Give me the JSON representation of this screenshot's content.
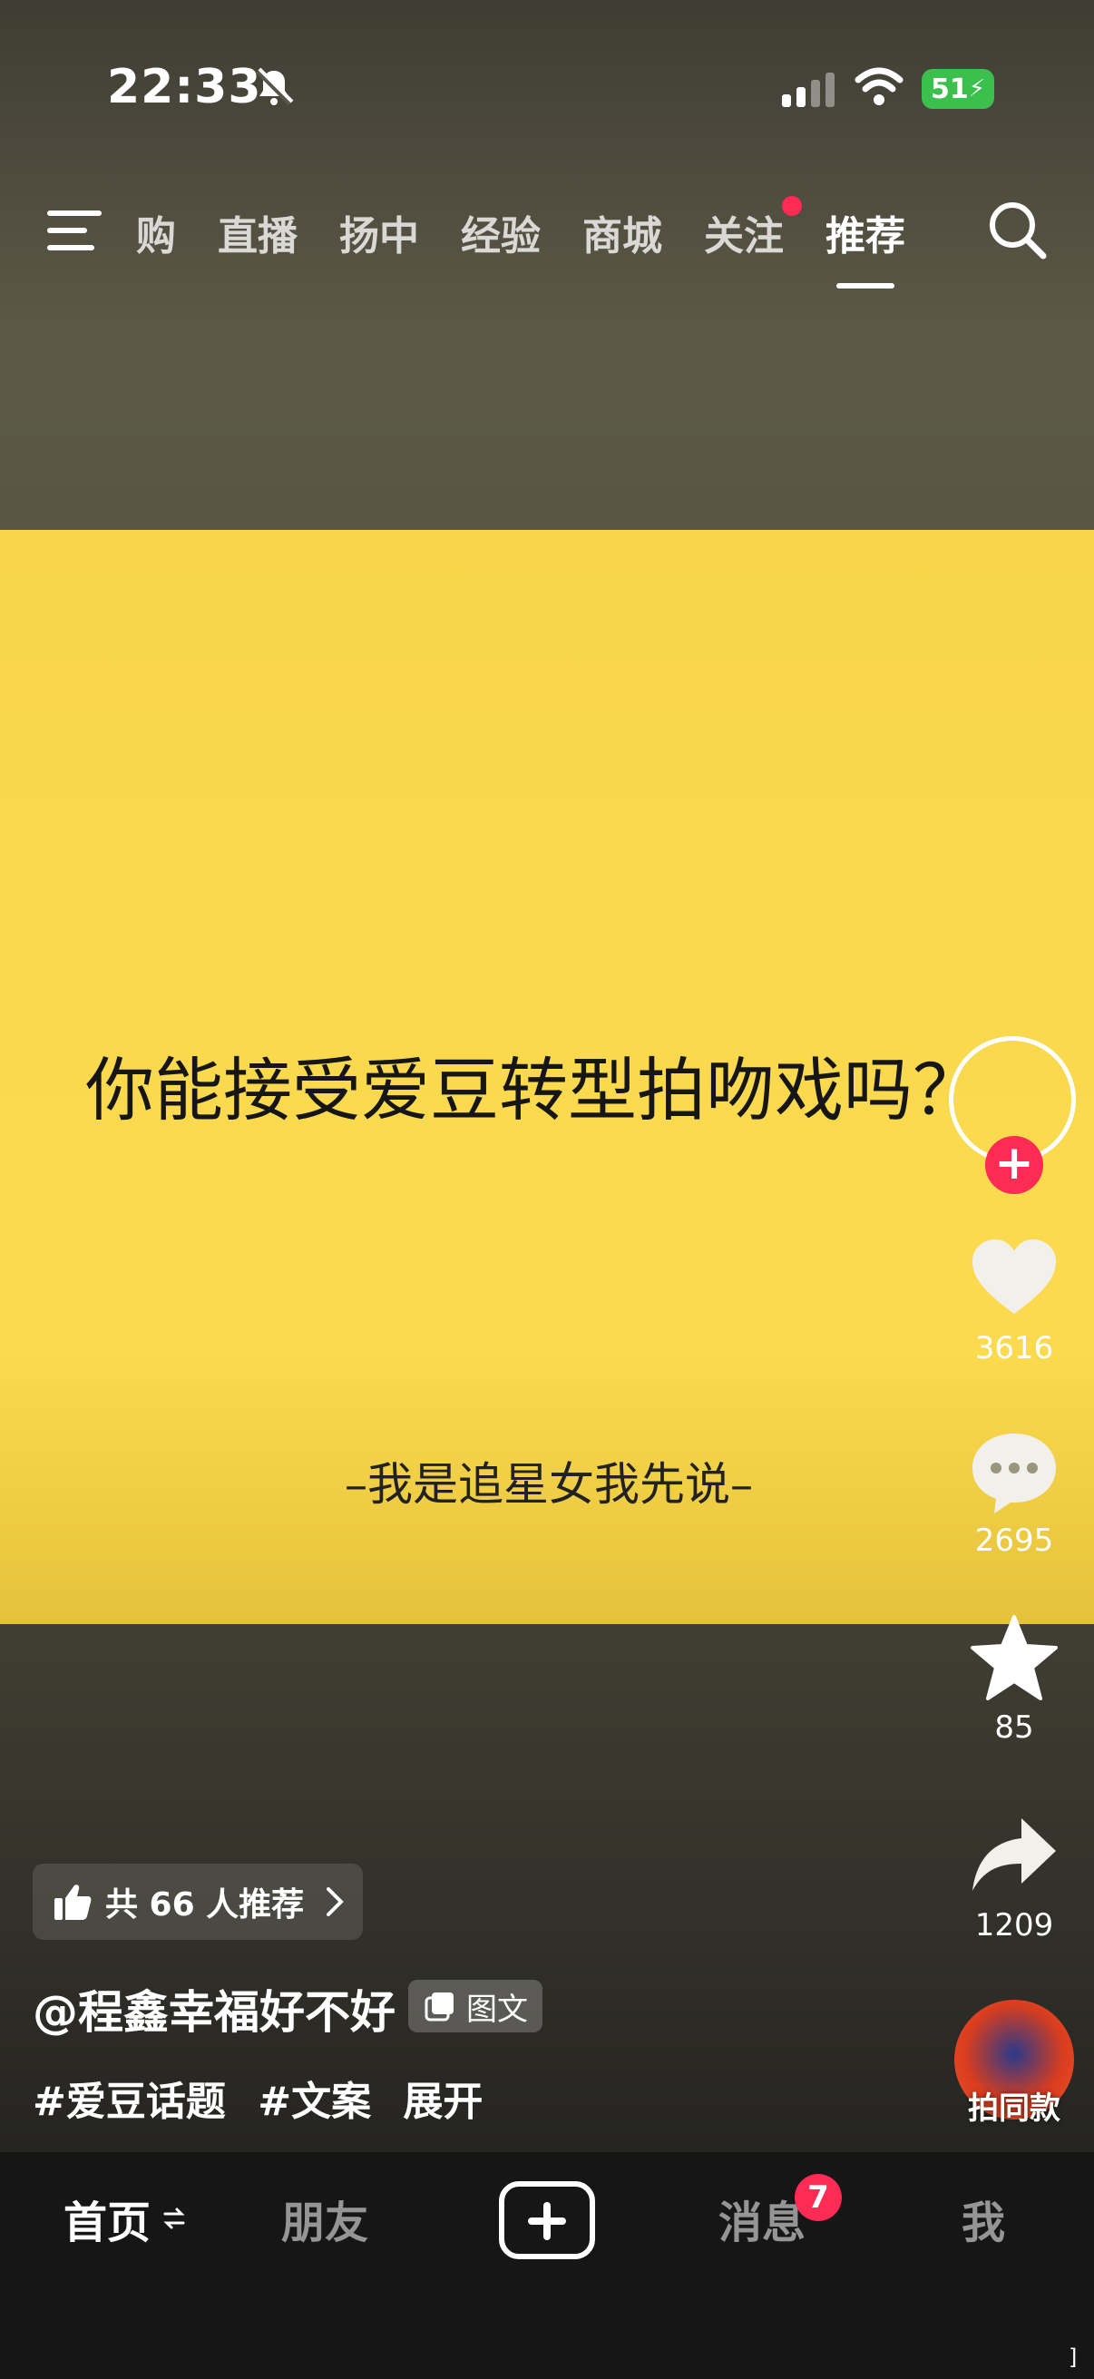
{
  "status_bar": {
    "time": "22:33",
    "battery": "51"
  },
  "top_nav": {
    "tabs": [
      {
        "label": "购"
      },
      {
        "label": "直播"
      },
      {
        "label": "扬中"
      },
      {
        "label": "经验"
      },
      {
        "label": "商城"
      },
      {
        "label": "关注"
      },
      {
        "label": "推荐"
      }
    ],
    "active_tab": "推荐"
  },
  "post": {
    "title": "你能接受爱豆转型拍吻戏吗？",
    "subtitle": "–我是追星女我先说–",
    "card_color": "#fbd94f"
  },
  "rail": {
    "like_count": "3616",
    "comment_count": "2695",
    "favorite_count": "85",
    "share_count": "1209",
    "music_label": "拍同款"
  },
  "caption": {
    "recommend_text": "共 66 人推荐",
    "author": "@程鑫幸福好不好",
    "badge": "图文",
    "hashtags": [
      "#爱豆话题",
      "#文案"
    ],
    "expand": "展开"
  },
  "bottom_nav": {
    "home": "首页",
    "friends": "朋友",
    "messages": "消息",
    "messages_badge": "7",
    "me": "我"
  },
  "colors": {
    "accent": "#fe2c55",
    "battery": "#3bbf4d",
    "nav_bg": "#161616"
  }
}
